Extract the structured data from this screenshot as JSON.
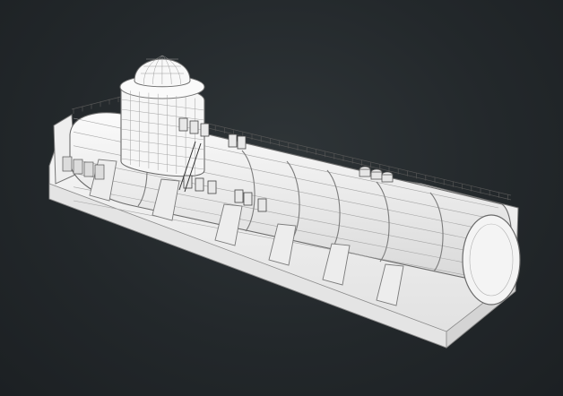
{
  "scene": {
    "subject": "submarine-hull-model",
    "colors": {
      "background": "#23282b",
      "model_fill": "#f2f2f2",
      "model_shade": "#dcdcdc",
      "wire": "#9a9a9a",
      "edge": "#6c6c6c",
      "dark_detail": "#4a4a4a"
    }
  }
}
